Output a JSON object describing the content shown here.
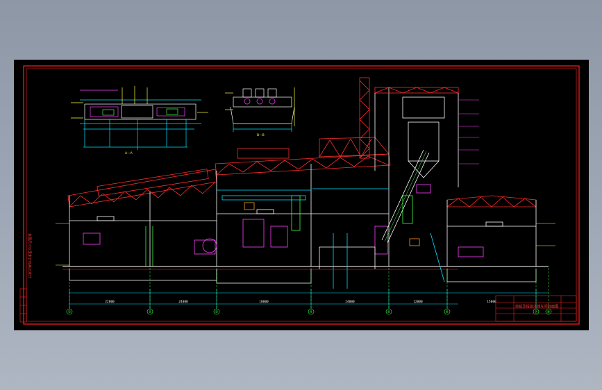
{
  "window": {
    "title": ""
  },
  "title_block": {
    "drawing_title": "熔铅及铅锭浇铸车间剖面图",
    "rows": [
      "",
      "",
      "",
      ""
    ]
  },
  "left_note": "本图尺寸以毫米计标高以米计",
  "axes": {
    "column_labels": [
      "①",
      "②",
      "③",
      "④",
      "⑤",
      "⑥",
      "⑦",
      "⑧"
    ]
  },
  "dimensions": {
    "bays": [
      "22800",
      "24000",
      "18000",
      "24000",
      "12000",
      "15000"
    ]
  },
  "details": {
    "left_plan_label": "A—A",
    "middle_plan_label": "B—B"
  },
  "colors": {
    "frame": "#ff2020",
    "steel": "#ff2d2d",
    "walls": "#ffffff",
    "equipment": "#ff40ff",
    "dims": "#00e5ff",
    "annot": "#ffff40",
    "green": "#40ff40",
    "orange": "#ff9a20"
  }
}
